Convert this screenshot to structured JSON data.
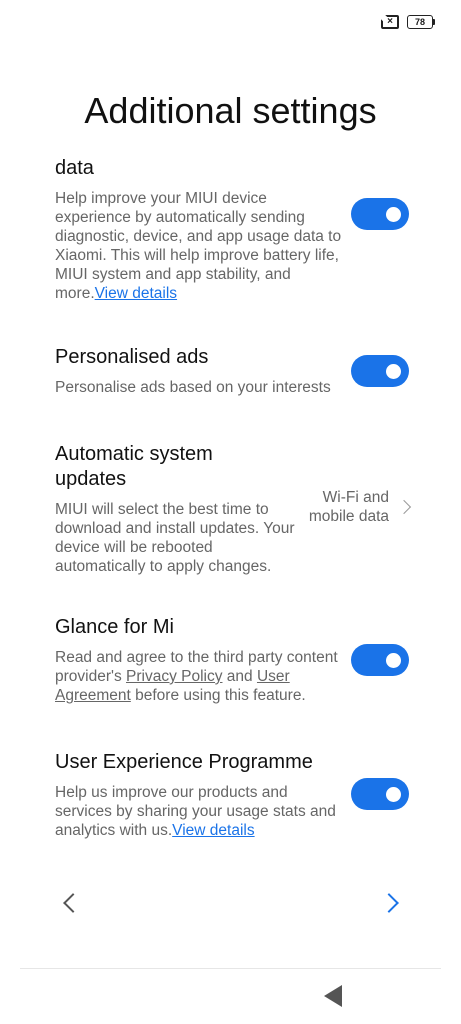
{
  "status": {
    "battery": "78"
  },
  "page": {
    "title": "Additional settings"
  },
  "settings": [
    {
      "title": "data",
      "desc": "Help improve your MIUI device experience by automatically sending diagnostic, device, and app usage data to Xiaomi. This will help improve battery life, MIUI system and app stability, and more.",
      "link": "View details",
      "toggle": true
    },
    {
      "title": "Personalised ads",
      "desc": "Personalise ads based on your interests",
      "toggle": true
    },
    {
      "title": "Automatic system updates",
      "desc": "MIUI will select the best time to download and install updates. Your device will be rebooted automatically to apply changes.",
      "value_line1": "Wi-Fi and",
      "value_line2": "mobile data"
    },
    {
      "title": "Glance for Mi",
      "desc_parts": [
        "Read and agree to the third party content provider's ",
        "Privacy Policy",
        " and ",
        "User Agreement",
        " before using this feature."
      ],
      "toggle": true
    },
    {
      "title": "User Experience Programme",
      "desc": "Help us improve our products and services by sharing your usage stats and analytics with us.",
      "link": "View details",
      "toggle": true
    }
  ],
  "colors": {
    "accent": "#1a73e8",
    "text": "#111111",
    "muted": "#666666"
  },
  "icons": {
    "sim": "sim-x-icon",
    "battery": "battery-icon",
    "prev": "chevron-left-icon",
    "next": "chevron-right-icon",
    "back": "back-triangle-icon"
  }
}
